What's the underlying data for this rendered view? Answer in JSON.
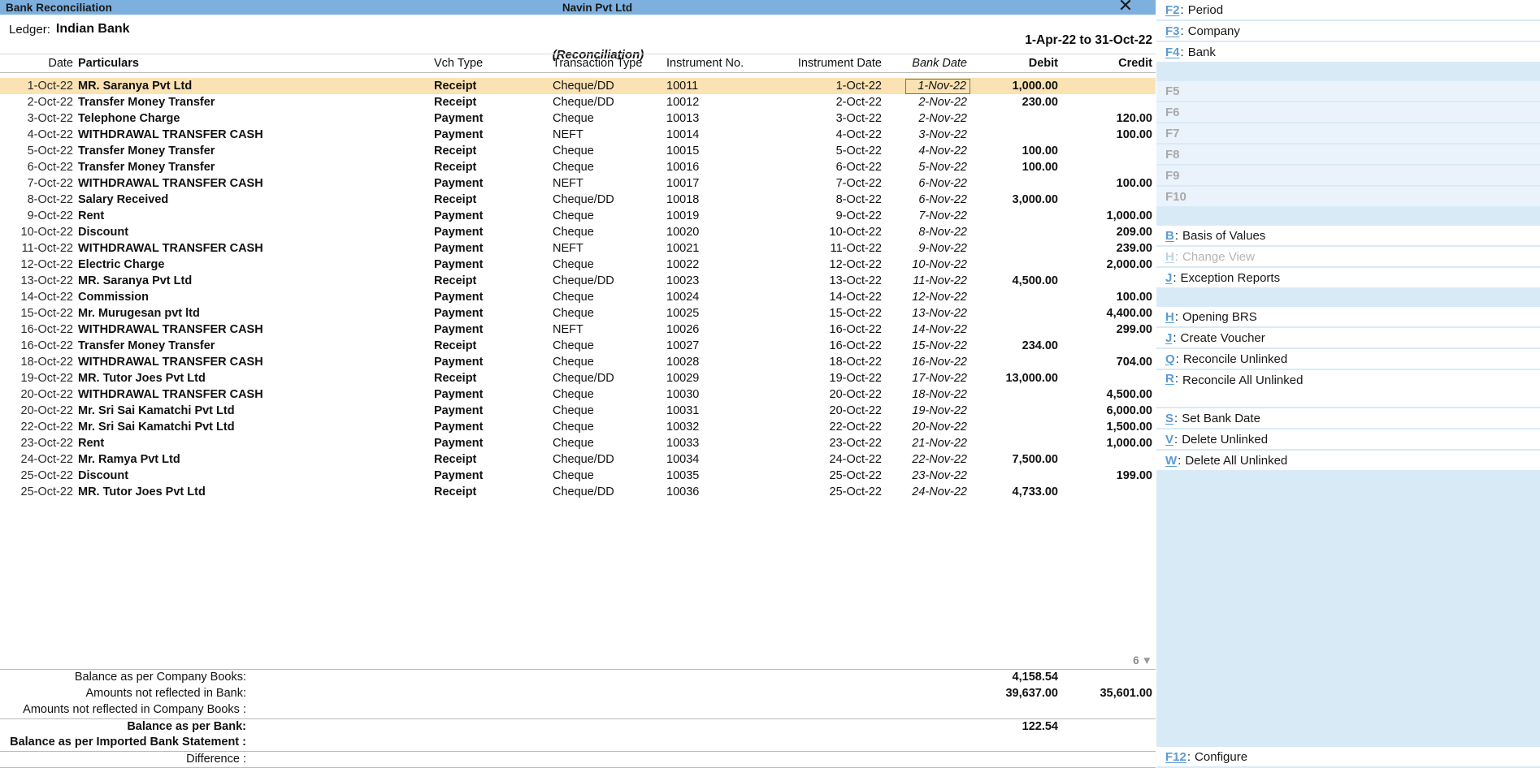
{
  "window": {
    "title": "Bank Reconciliation",
    "company": "Navin Pvt Ltd",
    "close_icon": "close-icon"
  },
  "header": {
    "ledger_label": "Ledger:",
    "ledger_value": "Indian Bank",
    "period": "1-Apr-22 to 31-Oct-22",
    "subtitle": "(Reconciliation)"
  },
  "table": {
    "columns": [
      "Date",
      "Particulars",
      "Vch Type",
      "Transaction Type",
      "Instrument No.",
      "Instrument Date",
      "Bank Date",
      "Debit",
      "Credit"
    ],
    "rows": [
      {
        "date": "1-Oct-22",
        "particulars": "MR. Saranya Pvt Ltd",
        "vch": "Receipt",
        "ttype": "Cheque/DD",
        "inst": "10011",
        "idate": "1-Oct-22",
        "bdate": "1-Nov-22",
        "debit": "1,000.00",
        "credit": "",
        "selected": true
      },
      {
        "date": "2-Oct-22",
        "particulars": "Transfer Money Transfer",
        "vch": "Receipt",
        "ttype": "Cheque/DD",
        "inst": "10012",
        "idate": "2-Oct-22",
        "bdate": "2-Nov-22",
        "debit": "230.00",
        "credit": "",
        "selected": false
      },
      {
        "date": "3-Oct-22",
        "particulars": "Telephone Charge",
        "vch": "Payment",
        "ttype": "Cheque",
        "inst": "10013",
        "idate": "3-Oct-22",
        "bdate": "2-Nov-22",
        "debit": "",
        "credit": "120.00",
        "selected": false
      },
      {
        "date": "4-Oct-22",
        "particulars": "WITHDRAWAL TRANSFER CASH",
        "vch": "Payment",
        "ttype": "NEFT",
        "inst": "10014",
        "idate": "4-Oct-22",
        "bdate": "3-Nov-22",
        "debit": "",
        "credit": "100.00",
        "selected": false
      },
      {
        "date": "5-Oct-22",
        "particulars": "Transfer Money Transfer",
        "vch": "Receipt",
        "ttype": "Cheque",
        "inst": "10015",
        "idate": "5-Oct-22",
        "bdate": "4-Nov-22",
        "debit": "100.00",
        "credit": "",
        "selected": false
      },
      {
        "date": "6-Oct-22",
        "particulars": "Transfer Money Transfer",
        "vch": "Receipt",
        "ttype": "Cheque",
        "inst": "10016",
        "idate": "6-Oct-22",
        "bdate": "5-Nov-22",
        "debit": "100.00",
        "credit": "",
        "selected": false
      },
      {
        "date": "7-Oct-22",
        "particulars": "WITHDRAWAL TRANSFER CASH",
        "vch": "Payment",
        "ttype": "NEFT",
        "inst": "10017",
        "idate": "7-Oct-22",
        "bdate": "6-Nov-22",
        "debit": "",
        "credit": "100.00",
        "selected": false
      },
      {
        "date": "8-Oct-22",
        "particulars": "Salary Received",
        "vch": "Receipt",
        "ttype": "Cheque/DD",
        "inst": "10018",
        "idate": "8-Oct-22",
        "bdate": "6-Nov-22",
        "debit": "3,000.00",
        "credit": "",
        "selected": false
      },
      {
        "date": "9-Oct-22",
        "particulars": "Rent",
        "vch": "Payment",
        "ttype": "Cheque",
        "inst": "10019",
        "idate": "9-Oct-22",
        "bdate": "7-Nov-22",
        "debit": "",
        "credit": "1,000.00",
        "selected": false
      },
      {
        "date": "10-Oct-22",
        "particulars": "Discount",
        "vch": "Payment",
        "ttype": "Cheque",
        "inst": "10020",
        "idate": "10-Oct-22",
        "bdate": "8-Nov-22",
        "debit": "",
        "credit": "209.00",
        "selected": false
      },
      {
        "date": "11-Oct-22",
        "particulars": "WITHDRAWAL TRANSFER CASH",
        "vch": "Payment",
        "ttype": "NEFT",
        "inst": "10021",
        "idate": "11-Oct-22",
        "bdate": "9-Nov-22",
        "debit": "",
        "credit": "239.00",
        "selected": false
      },
      {
        "date": "12-Oct-22",
        "particulars": "Electric Charge",
        "vch": "Payment",
        "ttype": "Cheque",
        "inst": "10022",
        "idate": "12-Oct-22",
        "bdate": "10-Nov-22",
        "debit": "",
        "credit": "2,000.00",
        "selected": false
      },
      {
        "date": "13-Oct-22",
        "particulars": "MR. Saranya Pvt Ltd",
        "vch": "Receipt",
        "ttype": "Cheque/DD",
        "inst": "10023",
        "idate": "13-Oct-22",
        "bdate": "11-Nov-22",
        "debit": "4,500.00",
        "credit": "",
        "selected": false
      },
      {
        "date": "14-Oct-22",
        "particulars": "Commission",
        "vch": "Payment",
        "ttype": "Cheque",
        "inst": "10024",
        "idate": "14-Oct-22",
        "bdate": "12-Nov-22",
        "debit": "",
        "credit": "100.00",
        "selected": false
      },
      {
        "date": "15-Oct-22",
        "particulars": "Mr. Murugesan pvt ltd",
        "vch": "Payment",
        "ttype": "Cheque",
        "inst": "10025",
        "idate": "15-Oct-22",
        "bdate": "13-Nov-22",
        "debit": "",
        "credit": "4,400.00",
        "selected": false
      },
      {
        "date": "16-Oct-22",
        "particulars": "WITHDRAWAL TRANSFER CASH",
        "vch": "Payment",
        "ttype": "NEFT",
        "inst": "10026",
        "idate": "16-Oct-22",
        "bdate": "14-Nov-22",
        "debit": "",
        "credit": "299.00",
        "selected": false
      },
      {
        "date": "16-Oct-22",
        "particulars": "Transfer Money Transfer",
        "vch": "Receipt",
        "ttype": "Cheque",
        "inst": "10027",
        "idate": "16-Oct-22",
        "bdate": "15-Nov-22",
        "debit": "234.00",
        "credit": "",
        "selected": false
      },
      {
        "date": "18-Oct-22",
        "particulars": "WITHDRAWAL TRANSFER CASH",
        "vch": "Payment",
        "ttype": "Cheque",
        "inst": "10028",
        "idate": "18-Oct-22",
        "bdate": "16-Nov-22",
        "debit": "",
        "credit": "704.00",
        "selected": false
      },
      {
        "date": "19-Oct-22",
        "particulars": "MR. Tutor Joes Pvt Ltd",
        "vch": "Receipt",
        "ttype": "Cheque/DD",
        "inst": "10029",
        "idate": "19-Oct-22",
        "bdate": "17-Nov-22",
        "debit": "13,000.00",
        "credit": "",
        "selected": false
      },
      {
        "date": "20-Oct-22",
        "particulars": "WITHDRAWAL TRANSFER CASH",
        "vch": "Payment",
        "ttype": "Cheque",
        "inst": "10030",
        "idate": "20-Oct-22",
        "bdate": "18-Nov-22",
        "debit": "",
        "credit": "4,500.00",
        "selected": false
      },
      {
        "date": "20-Oct-22",
        "particulars": "Mr. Sri Sai Kamatchi Pvt Ltd",
        "vch": "Payment",
        "ttype": "Cheque",
        "inst": "10031",
        "idate": "20-Oct-22",
        "bdate": "19-Nov-22",
        "debit": "",
        "credit": "6,000.00",
        "selected": false
      },
      {
        "date": "22-Oct-22",
        "particulars": "Mr. Sri Sai Kamatchi Pvt Ltd",
        "vch": "Payment",
        "ttype": "Cheque",
        "inst": "10032",
        "idate": "22-Oct-22",
        "bdate": "20-Nov-22",
        "debit": "",
        "credit": "1,500.00",
        "selected": false
      },
      {
        "date": "23-Oct-22",
        "particulars": "Rent",
        "vch": "Payment",
        "ttype": "Cheque",
        "inst": "10033",
        "idate": "23-Oct-22",
        "bdate": "21-Nov-22",
        "debit": "",
        "credit": "1,000.00",
        "selected": false
      },
      {
        "date": "24-Oct-22",
        "particulars": "Mr. Ramya  Pvt Ltd",
        "vch": "Receipt",
        "ttype": "Cheque/DD",
        "inst": "10034",
        "idate": "24-Oct-22",
        "bdate": "22-Nov-22",
        "debit": "7,500.00",
        "credit": "",
        "selected": false
      },
      {
        "date": "25-Oct-22",
        "particulars": "Discount",
        "vch": "Payment",
        "ttype": "Cheque",
        "inst": "10035",
        "idate": "25-Oct-22",
        "bdate": "23-Nov-22",
        "debit": "",
        "credit": "199.00",
        "selected": false
      },
      {
        "date": "25-Oct-22",
        "particulars": "MR. Tutor Joes Pvt Ltd",
        "vch": "Receipt",
        "ttype": "Cheque/DD",
        "inst": "10036",
        "idate": "25-Oct-22",
        "bdate": "24-Nov-22",
        "debit": "4,733.00",
        "credit": "",
        "selected": false
      }
    ],
    "more_count": "6",
    "more_arrow": "▼"
  },
  "footer": {
    "rows": [
      {
        "label": "Balance as per Company Books:",
        "debit": "4,158.54",
        "credit": "",
        "bold": false,
        "sep": false
      },
      {
        "label": "Amounts not reflected in Bank:",
        "debit": "39,637.00",
        "credit": "35,601.00",
        "bold": false,
        "sep": false
      },
      {
        "label": "Amounts not reflected in Company Books :",
        "debit": "",
        "credit": "",
        "bold": false,
        "sep": false
      },
      {
        "label": "Balance as per Bank:",
        "debit": "122.54",
        "credit": "",
        "bold": true,
        "sep": true
      },
      {
        "label": "Balance as per Imported Bank Statement :",
        "debit": "",
        "credit": "",
        "bold": true,
        "sep": false
      },
      {
        "label": "Difference :",
        "debit": "",
        "credit": "",
        "bold": false,
        "sep": true
      }
    ]
  },
  "sidebar": {
    "top_items": [
      {
        "key": "F2",
        "label": "Period",
        "disabled": false
      },
      {
        "key": "F3",
        "label": "Company",
        "disabled": false
      },
      {
        "key": "F4",
        "label": "Bank",
        "disabled": false
      }
    ],
    "fn_items": [
      {
        "key": "F5"
      },
      {
        "key": "F6"
      },
      {
        "key": "F7"
      },
      {
        "key": "F8"
      },
      {
        "key": "F9"
      },
      {
        "key": "F10"
      }
    ],
    "group_a": [
      {
        "key": "B",
        "label": "Basis of Values",
        "disabled": false
      },
      {
        "key": "H",
        "label": "Change View",
        "disabled": true
      },
      {
        "key": "J",
        "label": "Exception Reports",
        "disabled": false
      }
    ],
    "group_b": [
      {
        "key": "H",
        "label": "Opening BRS",
        "disabled": false,
        "two": false
      },
      {
        "key": "J",
        "label": "Create Voucher",
        "disabled": false,
        "two": false
      },
      {
        "key": "Q",
        "label": "Reconcile Unlinked",
        "disabled": false,
        "two": false
      },
      {
        "key": "R",
        "label": "Reconcile All Unlinked",
        "disabled": false,
        "two": true
      },
      {
        "key": "S",
        "label": "Set Bank Date",
        "disabled": false,
        "two": false
      },
      {
        "key": "V",
        "label": "Delete Unlinked",
        "disabled": false,
        "two": false
      },
      {
        "key": "W",
        "label": "Delete All Unlinked",
        "disabled": false,
        "two": false
      }
    ],
    "bottom_items": [
      {
        "key": "F12",
        "label": "Configure",
        "disabled": false
      }
    ]
  },
  "colors": {
    "titlebar": "#7db0de",
    "sidebar_bg": "#d9eaf7",
    "selected_row": "#fbe2b3",
    "accent_key": "#5b9bd5"
  }
}
